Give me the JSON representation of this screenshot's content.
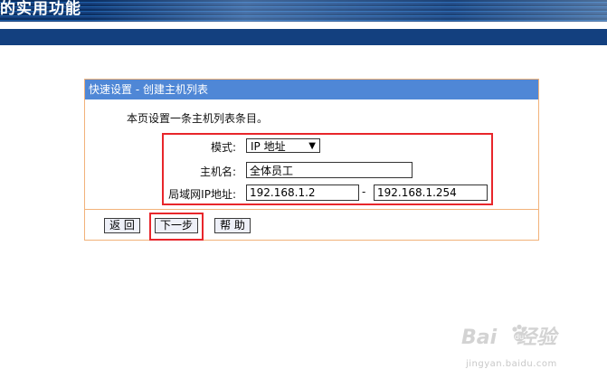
{
  "banner": {
    "title": "的实用功能"
  },
  "panel": {
    "header": "快速设置 - 创建主机列表",
    "intro": "本页设置一条主机列表条目。"
  },
  "form": {
    "mode_label": "模式:",
    "mode_value": "IP 地址",
    "hostname_label": "主机名:",
    "hostname_value": "全体员工",
    "lan_ip_label": "局域网IP地址:",
    "ip_start": "192.168.1.2",
    "ip_separator": "-",
    "ip_end": "192.168.1.254"
  },
  "buttons": {
    "back": "返 回",
    "next": "下一步",
    "help": "帮 助"
  },
  "watermark": {
    "brand_left": "Bai",
    "brand_right": "经验",
    "url": "jingyan.baidu.com"
  },
  "colors": {
    "panel_header": "#4f87d6",
    "panel_border": "#f2b27a",
    "highlight": "#e8262b",
    "navbar": "#13407f"
  }
}
